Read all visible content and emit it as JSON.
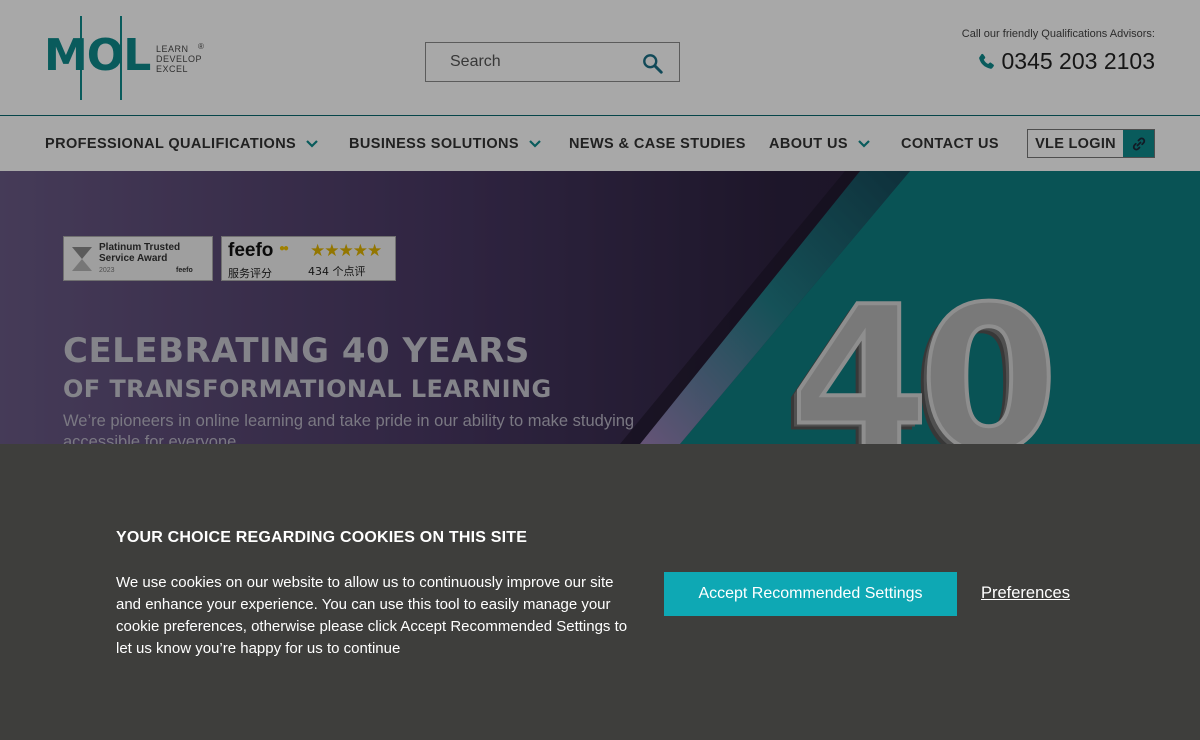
{
  "header": {
    "logo": {
      "text": "MOL",
      "tagline": [
        "LEARN",
        "DEVELOP",
        "EXCEL"
      ],
      "registered": "®"
    },
    "search": {
      "placeholder": "Search",
      "icon": "search-icon"
    },
    "call_label": "Call our friendly Qualifications Advisors:",
    "phone": "0345 203 2103"
  },
  "nav": {
    "items": [
      {
        "label": "PROFESSIONAL QUALIFICATIONS",
        "dropdown": true
      },
      {
        "label": "BUSINESS SOLUTIONS",
        "dropdown": true
      },
      {
        "label": "NEWS & CASE STUDIES",
        "dropdown": false
      },
      {
        "label": "ABOUT US",
        "dropdown": true
      },
      {
        "label": "CONTACT US",
        "dropdown": false
      }
    ],
    "vle_login": "VLE LOGIN"
  },
  "hero": {
    "badge_award": {
      "line1": "Platinum Trusted",
      "line2": "Service Award",
      "year": "2023",
      "brand": "feefo"
    },
    "badge_feefo": {
      "logo": "feefo",
      "subtitle": "服务评分",
      "count": "434 个点评",
      "stars": "★★★★★"
    },
    "title": "CELEBRATING 40 YEARS",
    "subtitle": "OF TRANSFORMATIONAL LEARNING",
    "text": "We’re pioneers in online learning and take pride in our ability to make studying accessible for everyone",
    "big_number": "40"
  },
  "cookie": {
    "title": "YOUR CHOICE REGARDING COOKIES ON THIS SITE",
    "body": "We use cookies on our website to allow us to continuously improve our site and enhance your experience. You can use this tool to easily manage your cookie preferences, otherwise please click Accept Recommended Settings to let us know you’re happy for us to continue",
    "accept_label": "Accept Recommended Settings",
    "preferences_label": "Preferences"
  },
  "colors": {
    "brand_teal": "#0e8a8c",
    "accept_button": "#0ea8b4",
    "banner_bg": "#3e3e3c"
  }
}
